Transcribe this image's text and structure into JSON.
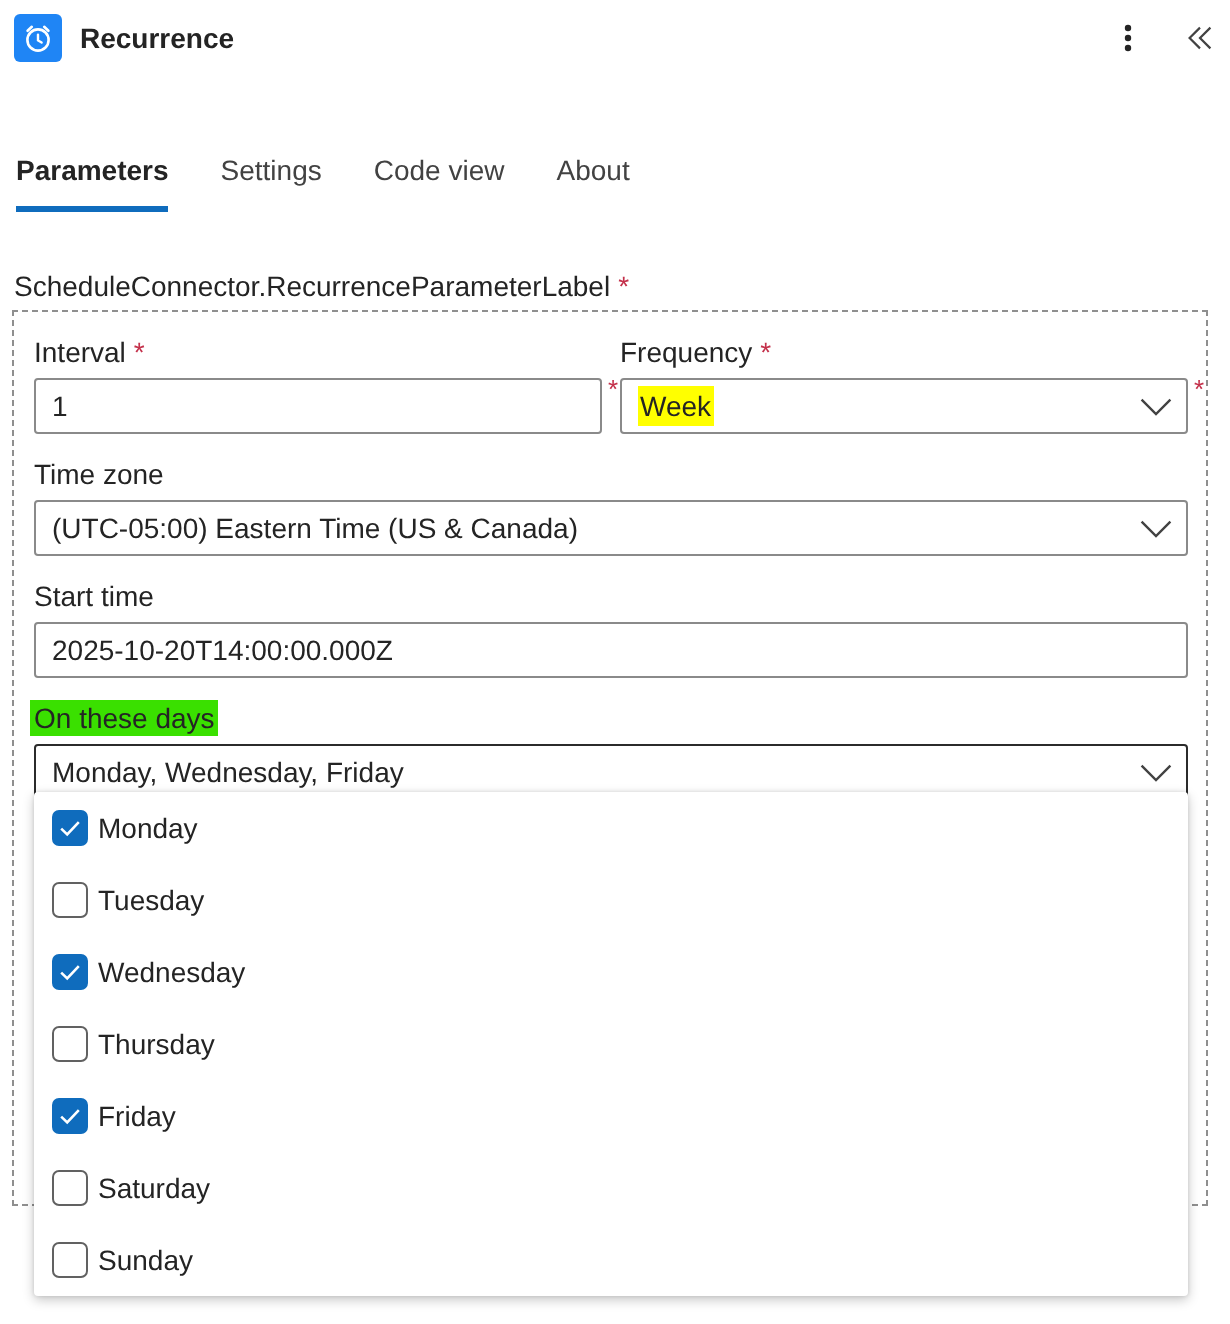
{
  "header": {
    "title": "Recurrence"
  },
  "tabs": [
    {
      "label": "Parameters",
      "selected": true
    },
    {
      "label": "Settings",
      "selected": false
    },
    {
      "label": "Code view",
      "selected": false
    },
    {
      "label": "About",
      "selected": false
    }
  ],
  "group": {
    "label": "ScheduleConnector.RecurrenceParameterLabel",
    "label_mark": "*",
    "rows": [
      [
        {
          "kind": "text",
          "label": "Interval",
          "label_mark": "*",
          "value": "1",
          "side_mark": "*"
        },
        {
          "kind": "dropdown",
          "label": "Frequency",
          "label_mark": "*",
          "value": "Week",
          "value_highlight": {
            "color": "#ffff00"
          },
          "expanded": false,
          "side_mark": "*"
        }
      ],
      [
        {
          "kind": "dropdown",
          "label": "Time zone",
          "value": "(UTC-05:00) Eastern Time (US & Canada)",
          "expanded": false
        }
      ],
      [
        {
          "kind": "text",
          "label": "Start time",
          "value": "2025-10-20T14:00:00.000Z"
        }
      ],
      [
        {
          "kind": "dropdown",
          "label": "On these days",
          "label_highlight": {
            "color": "#3ae000"
          },
          "value": "Monday, Wednesday, Friday",
          "expanded": true,
          "options": [
            {
              "label": "Monday",
              "checked": true
            },
            {
              "label": "Tuesday",
              "checked": false
            },
            {
              "label": "Wednesday",
              "checked": true
            },
            {
              "label": "Thursday",
              "checked": false
            },
            {
              "label": "Friday",
              "checked": true
            },
            {
              "label": "Saturday",
              "checked": false
            },
            {
              "label": "Sunday",
              "checked": false
            }
          ]
        }
      ]
    ]
  }
}
